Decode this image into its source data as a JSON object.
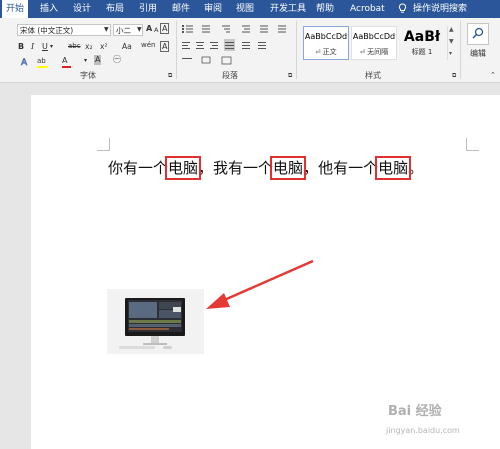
{
  "tabs": [
    "开始",
    "插入",
    "设计",
    "布局",
    "引用",
    "邮件",
    "审阅",
    "视图",
    "开发工具",
    "帮助",
    "Acrobat"
  ],
  "tell_me": "操作说明搜索",
  "font": {
    "name": "宋体 (中文正文)",
    "size": "小二",
    "bold": "B",
    "italic": "I",
    "underline": "U",
    "strike": "abc",
    "subscript": "x₂",
    "superscript": "x²",
    "grow": "A",
    "shrink": "A",
    "clear": "Aa",
    "char_border": "A",
    "phonetic": "wén",
    "font_color": "A",
    "highlight": "ab",
    "char_shade": "A",
    "enclose": "㊀",
    "label": "字体"
  },
  "paragraph": {
    "label": "段落"
  },
  "styles": {
    "label": "样式",
    "items": [
      {
        "sample": "AaBbCcDd",
        "name": "正文"
      },
      {
        "sample": "AaBbCcDd",
        "name": "无间隔"
      },
      {
        "sample": "AaBł",
        "name": "标题 1"
      }
    ]
  },
  "editing": {
    "label": "编辑"
  },
  "document": {
    "segments": [
      {
        "text": "你有一个",
        "hl": false
      },
      {
        "text": "电脑",
        "hl": true
      },
      {
        "text": "，我有一个",
        "hl": false
      },
      {
        "text": "电脑",
        "hl": true
      },
      {
        "text": "，他有一个",
        "hl": false
      },
      {
        "text": "电脑",
        "hl": true
      },
      {
        "text": "。",
        "hl": false
      }
    ]
  },
  "watermark": {
    "main": "Bai 经验",
    "sub": "jingyan.baidu.com"
  },
  "colors": {
    "accent": "#2b579a",
    "highlight_box": "#e03030",
    "arrow": "#e53935"
  }
}
